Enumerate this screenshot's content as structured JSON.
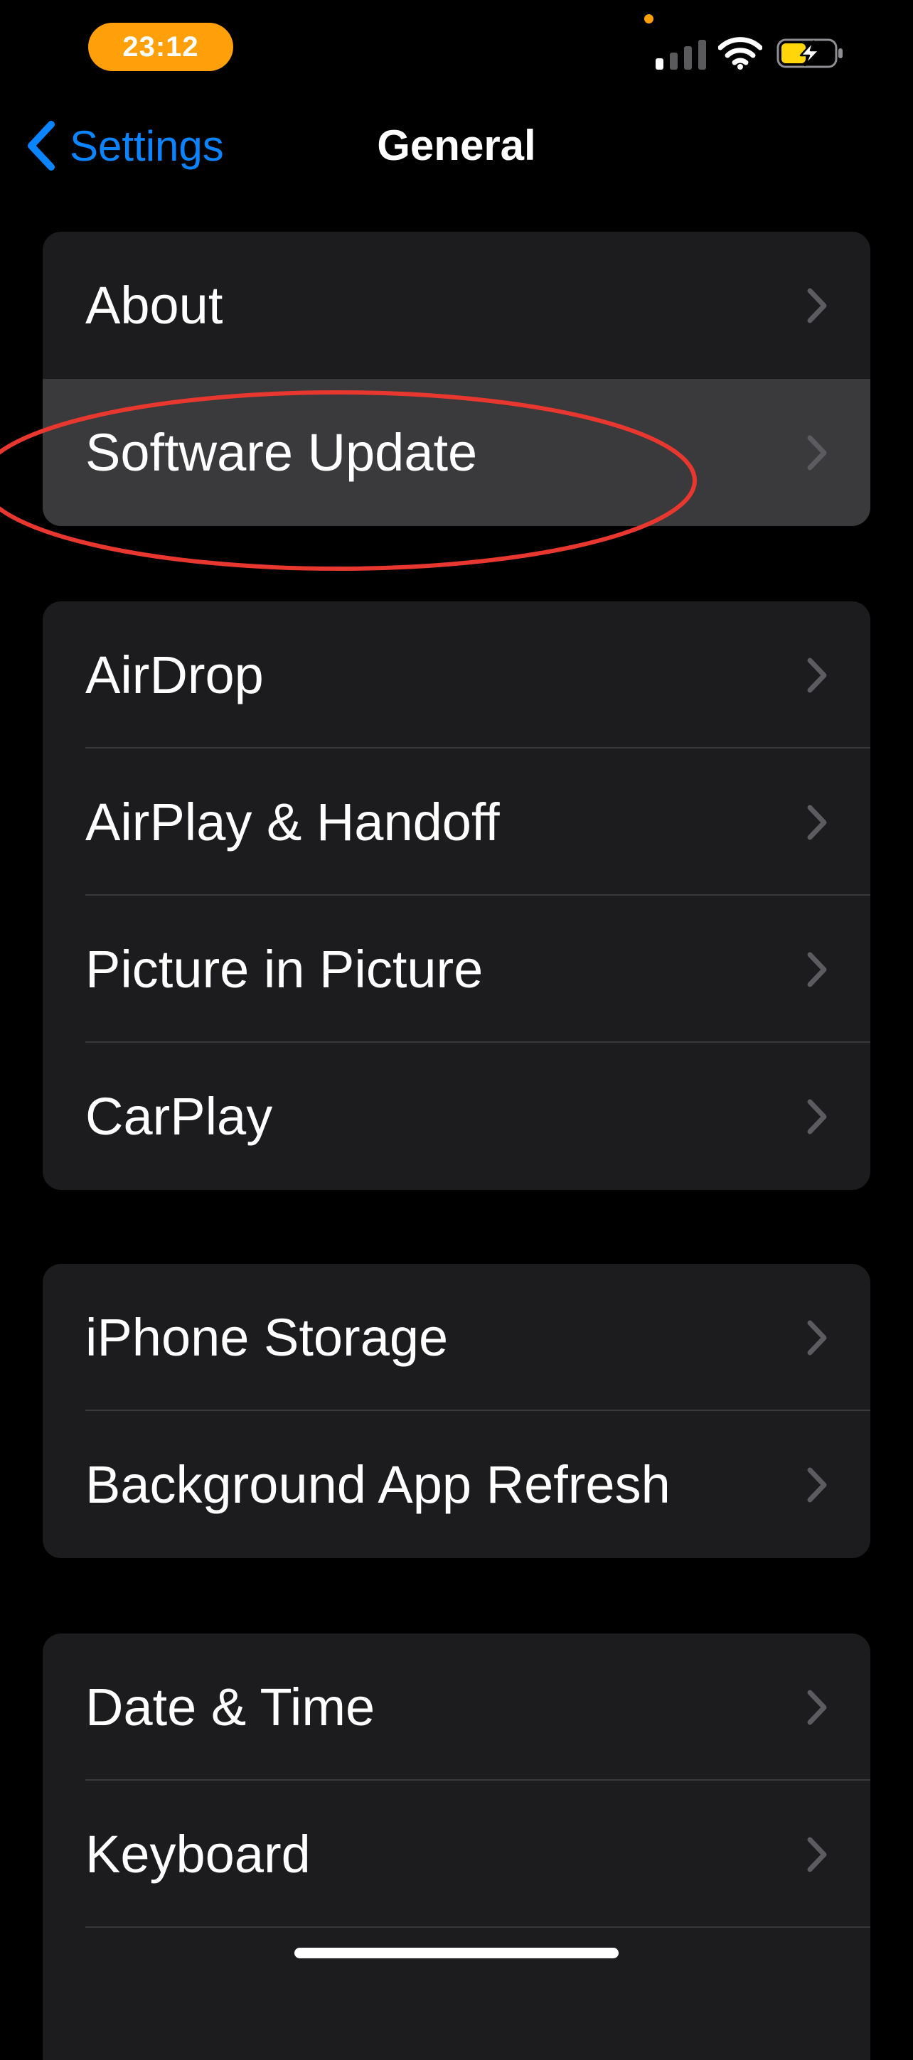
{
  "status_bar": {
    "time": "23:12",
    "accent_color": "#ff9f0a",
    "icons": [
      "signal-icon",
      "wifi-icon",
      "battery-charging-icon"
    ]
  },
  "nav": {
    "back_label": "Settings",
    "title": "General",
    "back_color": "#0a84ff"
  },
  "groups": [
    {
      "items": [
        {
          "label": "About"
        },
        {
          "label": "Software Update",
          "highlighted": true
        }
      ]
    },
    {
      "items": [
        {
          "label": "AirDrop"
        },
        {
          "label": "AirPlay & Handoff"
        },
        {
          "label": "Picture in Picture"
        },
        {
          "label": "CarPlay"
        }
      ]
    },
    {
      "items": [
        {
          "label": "iPhone Storage"
        },
        {
          "label": "Background App Refresh"
        }
      ]
    },
    {
      "items": [
        {
          "label": "Date & Time"
        },
        {
          "label": "Keyboard"
        }
      ]
    }
  ],
  "annotation_color": "#e8372e"
}
